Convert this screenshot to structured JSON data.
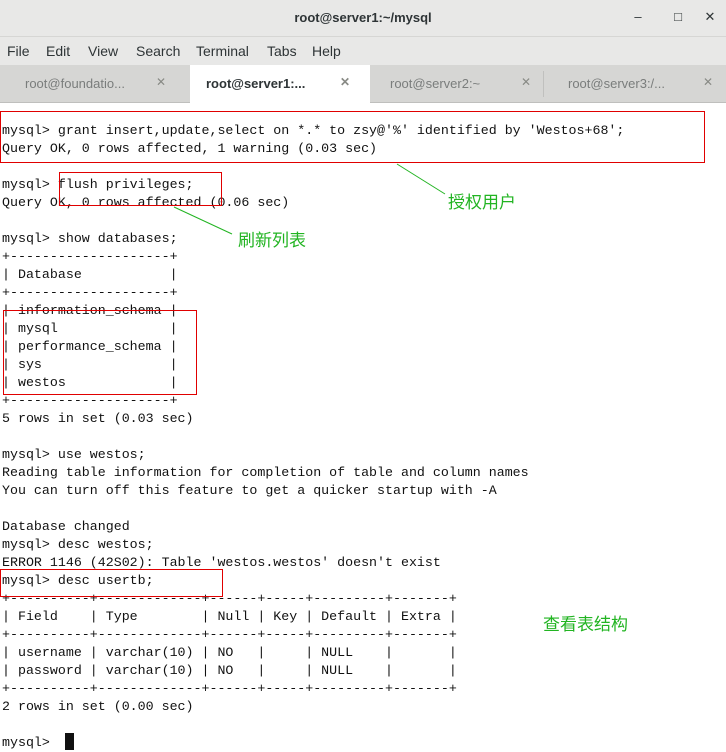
{
  "window": {
    "title": "root@server1:~/mysql",
    "controls": [
      "–",
      "□",
      "✕"
    ]
  },
  "menu": [
    "File",
    "Edit",
    "View",
    "Search",
    "Terminal",
    "Tabs",
    "Help"
  ],
  "tabs": [
    {
      "label": "root@foundatio...",
      "close": "✕"
    },
    {
      "label": "root@server1:...",
      "close": "✕"
    },
    {
      "label": "root@server2:~",
      "close": "✕"
    },
    {
      "label": "root@server3:/...",
      "close": "✕"
    }
  ],
  "terminal_lines": [
    "mysql> grant insert,update,select on *.* to zsy@'%' identified by 'Westos+68';",
    "Query OK, 0 rows affected, 1 warning (0.03 sec)",
    "",
    "mysql> flush privileges;",
    "Query OK, 0 rows affected (0.06 sec)",
    "",
    "mysql> show databases;",
    "+--------------------+",
    "| Database           |",
    "+--------------------+",
    "| information_schema |",
    "| mysql              |",
    "| performance_schema |",
    "| sys                |",
    "| westos             |",
    "+--------------------+",
    "5 rows in set (0.03 sec)",
    "",
    "mysql> use westos;",
    "Reading table information for completion of table and column names",
    "You can turn off this feature to get a quicker startup with -A",
    "",
    "Database changed",
    "mysql> desc westos;",
    "ERROR 1146 (42S02): Table 'westos.westos' doesn't exist",
    "mysql> desc usertb;",
    "+----------+-------------+------+-----+---------+-------+",
    "| Field    | Type        | Null | Key | Default | Extra |",
    "+----------+-------------+------+-----+---------+-------+",
    "| username | varchar(10) | NO   |     | NULL    |       |",
    "| password | varchar(10) | NO   |     | NULL    |       |",
    "+----------+-------------+------+-----+---------+-------+",
    "2 rows in set (0.00 sec)",
    "",
    "mysql> "
  ],
  "annotations": {
    "grant_label": "授权用户",
    "flush_label": "刷新列表",
    "desc_label": "查看表结构"
  },
  "colors": {
    "annotation": "#22b422",
    "highlight_box": "#e00000"
  }
}
